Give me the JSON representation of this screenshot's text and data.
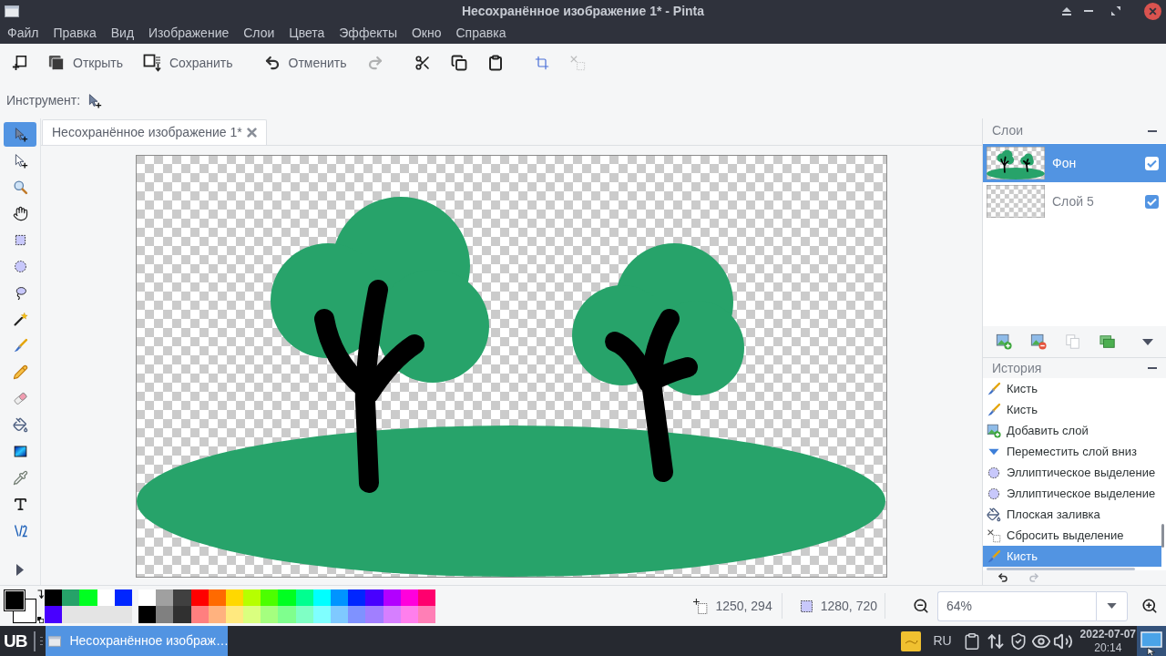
{
  "window": {
    "title": "Несохранённое изображение 1* - Pinta"
  },
  "menu": [
    "Файл",
    "Правка",
    "Вид",
    "Изображение",
    "Слои",
    "Цвета",
    "Эффекты",
    "Окно",
    "Справка"
  ],
  "toolbar": {
    "groups": [
      {
        "items": [
          {
            "kind": "new",
            "disabled": false
          },
          {
            "kind": "open",
            "label": "Открыть",
            "disabled": false
          },
          {
            "kind": "save",
            "label": "Сохранить",
            "disabled": false
          }
        ]
      },
      {
        "items": [
          {
            "kind": "undo",
            "label": "Отменить",
            "disabled": false
          },
          {
            "kind": "redo",
            "disabled": true
          }
        ]
      },
      {
        "items": [
          {
            "kind": "cut",
            "disabled": false
          },
          {
            "kind": "copy",
            "disabled": false
          },
          {
            "kind": "paste",
            "disabled": false
          }
        ]
      },
      {
        "items": [
          {
            "kind": "crop",
            "disabled": false
          },
          {
            "kind": "deselect",
            "disabled": true
          }
        ]
      }
    ]
  },
  "tool_options": {
    "label": "Инструмент:"
  },
  "tools": [
    {
      "kind": "move_selected",
      "selected": true
    },
    {
      "kind": "move_selection",
      "selected": false
    },
    {
      "kind": "zoom",
      "selected": false
    },
    {
      "kind": "pan",
      "selected": false
    },
    {
      "kind": "rect_select",
      "selected": false
    },
    {
      "kind": "ellipse_select",
      "selected": false
    },
    {
      "kind": "lasso",
      "selected": false
    },
    {
      "kind": "magic_wand",
      "selected": false
    },
    {
      "kind": "brush",
      "selected": false
    },
    {
      "kind": "pencil",
      "selected": false
    },
    {
      "kind": "eraser",
      "selected": false
    },
    {
      "kind": "bucket",
      "selected": false
    },
    {
      "kind": "gradient",
      "selected": false
    },
    {
      "kind": "picker",
      "selected": false
    },
    {
      "kind": "text",
      "selected": false
    },
    {
      "kind": "line",
      "selected": false
    }
  ],
  "document_tab": {
    "title": "Несохранённое изображение 1*",
    "selected": true
  },
  "layers": {
    "title": "Слои",
    "items": [
      {
        "name": "Фон",
        "kind": "scene",
        "selected": true,
        "visible": true
      },
      {
        "name": "Слой 5",
        "kind": "blank",
        "selected": false,
        "visible": true
      }
    ]
  },
  "history": {
    "title": "История",
    "items": [
      {
        "kind": "brush",
        "label": "Кисть",
        "selected": false
      },
      {
        "kind": "brush",
        "label": "Кисть",
        "selected": false
      },
      {
        "kind": "add_layer",
        "label": "Добавить слой",
        "selected": false
      },
      {
        "kind": "move_down",
        "label": "Переместить слой вниз",
        "selected": false
      },
      {
        "kind": "ellipse_select",
        "label": "Эллиптическое выделение",
        "selected": false
      },
      {
        "kind": "ellipse_select",
        "label": "Эллиптическое выделение",
        "selected": false
      },
      {
        "kind": "fill",
        "label": "Плоская заливка",
        "selected": false
      },
      {
        "kind": "deselect",
        "label": "Сбросить выделение",
        "selected": false
      },
      {
        "kind": "brush",
        "label": "Кисть",
        "selected": true
      }
    ]
  },
  "colors": {
    "primary": {
      "color": "#000000"
    },
    "secondary": {
      "color": "#ffffff"
    }
  },
  "palette": {
    "recent": [
      {
        "color": "#000000"
      },
      {
        "color": "#26a269"
      },
      {
        "color": "#00ff21"
      },
      {
        "color": "#ffffff"
      },
      {
        "color": "#0026ff"
      },
      {
        "color": "#4800ff"
      }
    ],
    "swatches": [
      {
        "color": "#ffffff"
      },
      {
        "color": "#a0a0a0"
      },
      {
        "color": "#404040"
      },
      {
        "color": "#ff0000"
      },
      {
        "color": "#ff6a00"
      },
      {
        "color": "#ffd800"
      },
      {
        "color": "#b6ff00"
      },
      {
        "color": "#4cff00"
      },
      {
        "color": "#00ff21"
      },
      {
        "color": "#00ff90"
      },
      {
        "color": "#00ffff"
      },
      {
        "color": "#0094ff"
      },
      {
        "color": "#0026ff"
      },
      {
        "color": "#4800ff"
      },
      {
        "color": "#b200ff"
      },
      {
        "color": "#ff00dc"
      },
      {
        "color": "#ff006e"
      },
      {
        "color": "#000000"
      },
      {
        "color": "#808080"
      },
      {
        "color": "#303030"
      },
      {
        "color": "#ff7f7f"
      },
      {
        "color": "#ffb27f"
      },
      {
        "color": "#ffe97f"
      },
      {
        "color": "#daff7f"
      },
      {
        "color": "#a5ff7f"
      },
      {
        "color": "#7fff8e"
      },
      {
        "color": "#7fffc5"
      },
      {
        "color": "#7fffff"
      },
      {
        "color": "#7fc9ff"
      },
      {
        "color": "#7f92ff"
      },
      {
        "color": "#a17fff"
      },
      {
        "color": "#d67fff"
      },
      {
        "color": "#ff7fed"
      },
      {
        "color": "#ff7fb6"
      }
    ]
  },
  "status": {
    "cursor": "1250, 294",
    "selection": "1280, 720",
    "zoom": "64%"
  },
  "taskbar": {
    "logo": "UB",
    "tasks": [
      {
        "title": "Несохранённое изображ…",
        "selected": true
      }
    ],
    "keyboard_layout": "RU",
    "date": "2022-07-07",
    "time": "20:14"
  }
}
